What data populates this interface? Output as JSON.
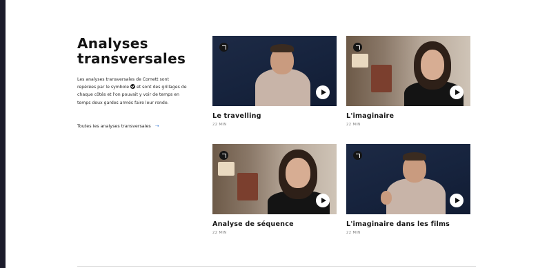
{
  "section": {
    "title": "Analyses transversales",
    "description_before": "Les analyses transversales de Comett sont repérées par le symbole",
    "description_after": "et sont des grillages de chaque côtés et l'on pouvait y voir de temps en temps deux gardes armés faire leur ronde.",
    "all_link_label": "Toutes les analyses transversales",
    "all_link_icon": "arrow-right-icon"
  },
  "cards": [
    {
      "title": "Le travelling",
      "duration": "22 MIN",
      "badge_icon": "expand-arrow-icon",
      "play_icon": "play-icon"
    },
    {
      "title": "L'imaginaire",
      "duration": "22 MIN",
      "badge_icon": "expand-arrow-icon",
      "play_icon": "play-icon"
    },
    {
      "title": "Analyse de séquence",
      "duration": "22 MIN",
      "badge_icon": "expand-arrow-icon",
      "play_icon": "play-icon"
    },
    {
      "title": "L'imaginaire dans les films",
      "duration": "22 MIN",
      "badge_icon": "expand-arrow-icon",
      "play_icon": "play-icon"
    }
  ],
  "colors": {
    "frame": "#1b1b2b",
    "background": "#ffffff",
    "link_accent": "#3a7bd5",
    "dark_thumb": "#16233d"
  }
}
